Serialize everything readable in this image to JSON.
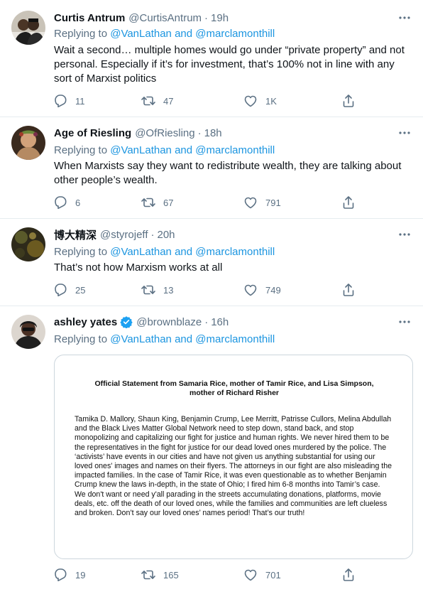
{
  "tweets": [
    {
      "name": "Curtis Antrum",
      "handle": "@CurtisAntrum",
      "time": "19h",
      "replying_prefix": "Replying to",
      "replying_to_1": "@VanLathan",
      "replying_and": "and",
      "replying_to_2": "@marclamonthill",
      "text": "Wait a second… multiple homes would go under “private property” and not personal. Especially if it’s for investment, that’s 100% not in line with any sort of Marxist politics",
      "replies": "11",
      "retweets": "47",
      "likes": "1K"
    },
    {
      "name": "Age of Riesling",
      "handle": "@OfRiesling",
      "time": "18h",
      "replying_prefix": "Replying to",
      "replying_to_1": "@VanLathan",
      "replying_and": "and",
      "replying_to_2": "@marclamonthill",
      "text": "When Marxists say they want to redistribute wealth, they are talking about other people’s wealth.",
      "replies": "6",
      "retweets": "67",
      "likes": "791"
    },
    {
      "name": "博大精深",
      "handle": "@styrojeff",
      "time": "20h",
      "replying_prefix": "Replying to",
      "replying_to_1": "@VanLathan",
      "replying_and": "and",
      "replying_to_2": "@marclamonthill",
      "text": "That’s not how Marxism works at all",
      "replies": "25",
      "retweets": "13",
      "likes": "749"
    },
    {
      "name": "ashley yates",
      "handle": "@brownblaze",
      "time": "16h",
      "verified": true,
      "replying_prefix": "Replying to",
      "replying_to_1": "@VanLathan",
      "replying_and": "and",
      "replying_to_2": "@marclamonthill",
      "replies": "19",
      "retweets": "165",
      "likes": "701",
      "image_statement": {
        "title": "Official Statement from Samaria Rice, mother of Tamir Rice, and Lisa Simpson, mother of Richard Risher",
        "body": "Tamika D. Mallory, Shaun King, Benjamin Crump, Lee Merritt, Patrisse Cullors, Melina Abdullah and the Black Lives Matter Global Network need to step down, stand back, and stop monopolizing and capitalizing our fight for justice and human rights. We never hired them to be the representatives in the fight for justice for our dead loved ones murdered by the police. The ‘activists’ have events in our cities and have not given us anything substantial for using our loved ones' images and names on their flyers. The attorneys in our fight are also misleading the impacted families. In the case of Tamir Rice, it was even questionable as to whether Benjamin Crump knew the laws in-depth, in the state of Ohio; I fired him 6-8 months into Tamir’s case.",
        "body2": "We don't want or need y'all parading in the streets accumulating donations, platforms, movie deals, etc. off the death of our loved ones, while the families and communities are left clueless and broken. Don’t say our loved ones’ names period! That’s our truth!"
      }
    }
  ],
  "icons": {
    "more": "more-icon",
    "reply": "reply-icon",
    "retweet": "retweet-icon",
    "like": "like-icon",
    "share": "share-icon",
    "verified": "verified-badge-icon"
  },
  "colors": {
    "text": "#0f1419",
    "secondary": "#5b7083",
    "link": "#1b95e0",
    "verified": "#1da1f2",
    "divider": "#e6ecf0"
  }
}
